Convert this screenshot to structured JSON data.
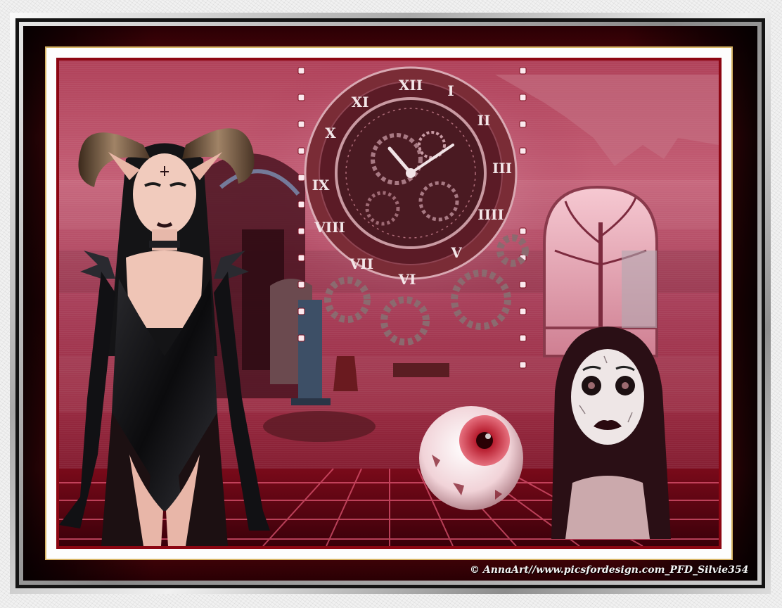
{
  "credit": "© AnnaArt//www.picsfordesign.com_PFD_Silvie354",
  "clock_numerals": [
    "XII",
    "I",
    "II",
    "III",
    "IIII",
    "V",
    "VI",
    "VII",
    "VIII",
    "IX",
    "X",
    "XI"
  ],
  "colors": {
    "frame_red": "#8e0b14",
    "scene_pink": "#c45f76",
    "gold_line": "#d8b566",
    "mat_white": "#fdfdfd"
  },
  "elements": [
    "horned-woman-figure",
    "clock-face",
    "gear-cluster",
    "gothic-interior",
    "tree-window",
    "doll-face-figure",
    "eyeball-sphere",
    "grid-floor"
  ]
}
